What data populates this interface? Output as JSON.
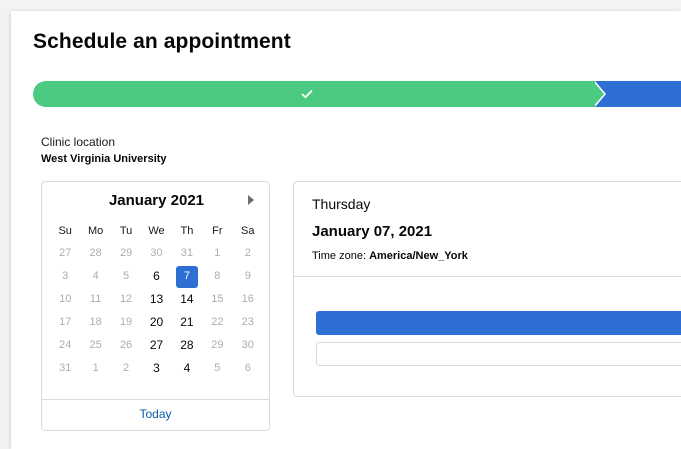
{
  "page": {
    "title": "Schedule an appointment"
  },
  "progress": {
    "steps": [
      {
        "state": "complete",
        "icon": "check-icon"
      },
      {
        "state": "current"
      }
    ],
    "colors": {
      "complete": "#4bca81",
      "current": "#2e6fd4"
    }
  },
  "location": {
    "label": "Clinic location",
    "value": "West Virginia University"
  },
  "calendar": {
    "month_label": "January 2021",
    "weekdays": [
      "Su",
      "Mo",
      "Tu",
      "We",
      "Th",
      "Fr",
      "Sa"
    ],
    "weeks": [
      [
        {
          "d": "27",
          "m": "other"
        },
        {
          "d": "28",
          "m": "other"
        },
        {
          "d": "29",
          "m": "other"
        },
        {
          "d": "30",
          "m": "other"
        },
        {
          "d": "31",
          "m": "other"
        },
        {
          "d": "1",
          "m": "other"
        },
        {
          "d": "2",
          "m": "other"
        }
      ],
      [
        {
          "d": "3",
          "m": "other"
        },
        {
          "d": "4",
          "m": "other"
        },
        {
          "d": "5",
          "m": "other"
        },
        {
          "d": "6",
          "m": "cur"
        },
        {
          "d": "7",
          "m": "sel"
        },
        {
          "d": "8",
          "m": "other"
        },
        {
          "d": "9",
          "m": "other"
        }
      ],
      [
        {
          "d": "10",
          "m": "other"
        },
        {
          "d": "11",
          "m": "other"
        },
        {
          "d": "12",
          "m": "other"
        },
        {
          "d": "13",
          "m": "cur"
        },
        {
          "d": "14",
          "m": "cur"
        },
        {
          "d": "15",
          "m": "other"
        },
        {
          "d": "16",
          "m": "other"
        }
      ],
      [
        {
          "d": "17",
          "m": "other"
        },
        {
          "d": "18",
          "m": "other"
        },
        {
          "d": "19",
          "m": "other"
        },
        {
          "d": "20",
          "m": "cur"
        },
        {
          "d": "21",
          "m": "cur"
        },
        {
          "d": "22",
          "m": "other"
        },
        {
          "d": "23",
          "m": "other"
        }
      ],
      [
        {
          "d": "24",
          "m": "other"
        },
        {
          "d": "25",
          "m": "other"
        },
        {
          "d": "26",
          "m": "other"
        },
        {
          "d": "27",
          "m": "cur"
        },
        {
          "d": "28",
          "m": "cur"
        },
        {
          "d": "29",
          "m": "other"
        },
        {
          "d": "30",
          "m": "other"
        }
      ],
      [
        {
          "d": "31",
          "m": "other"
        },
        {
          "d": "1",
          "m": "other"
        },
        {
          "d": "2",
          "m": "other"
        },
        {
          "d": "3",
          "m": "cur"
        },
        {
          "d": "4",
          "m": "cur"
        },
        {
          "d": "5",
          "m": "other"
        },
        {
          "d": "6",
          "m": "other"
        }
      ]
    ],
    "today_label": "Today",
    "selected_color": "#2e6fd4"
  },
  "details": {
    "day_name": "Thursday",
    "date": "January 07, 2021",
    "timezone_label": "Time zone: ",
    "timezone_value": "America/New_York"
  }
}
